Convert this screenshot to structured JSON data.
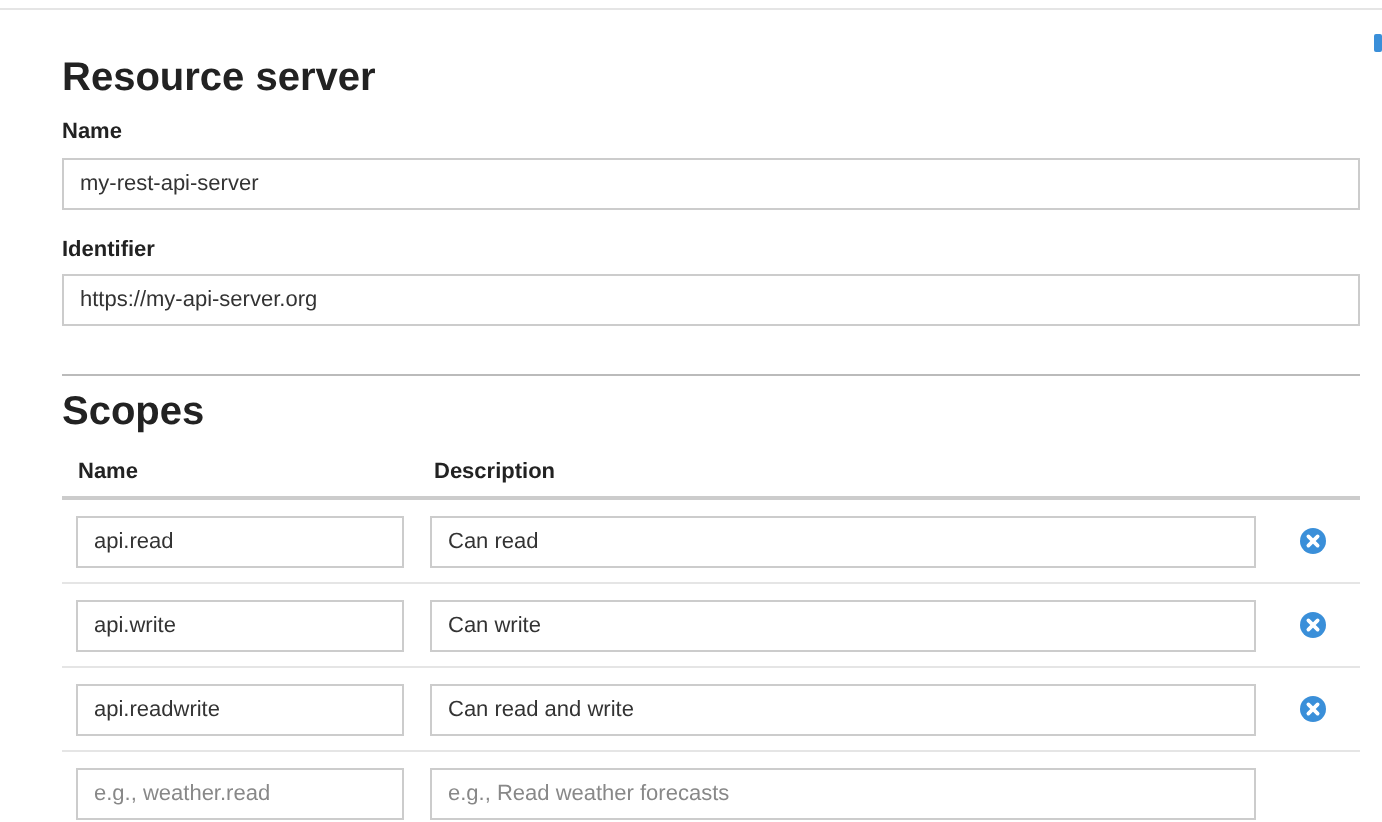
{
  "title": "Resource server",
  "fields": [
    {
      "label": "Name",
      "value": "my-rest-api-server"
    },
    {
      "label": "Identifier",
      "value": "https://my-api-server.org"
    }
  ],
  "scopes": {
    "title": "Scopes",
    "columns": [
      "Name",
      "Description"
    ],
    "rows": [
      {
        "name": {
          "value": "api.read"
        },
        "description": {
          "value": "Can read"
        },
        "removable": true
      },
      {
        "name": {
          "value": "api.write"
        },
        "description": {
          "value": "Can write"
        },
        "removable": true
      },
      {
        "name": {
          "value": "api.readwrite"
        },
        "description": {
          "value": "Can read and write"
        },
        "removable": true
      },
      {
        "name": {
          "placeholder": "e.g., weather.read"
        },
        "description": {
          "placeholder": "e.g., Read weather forecasts"
        },
        "removable": false
      }
    ]
  }
}
